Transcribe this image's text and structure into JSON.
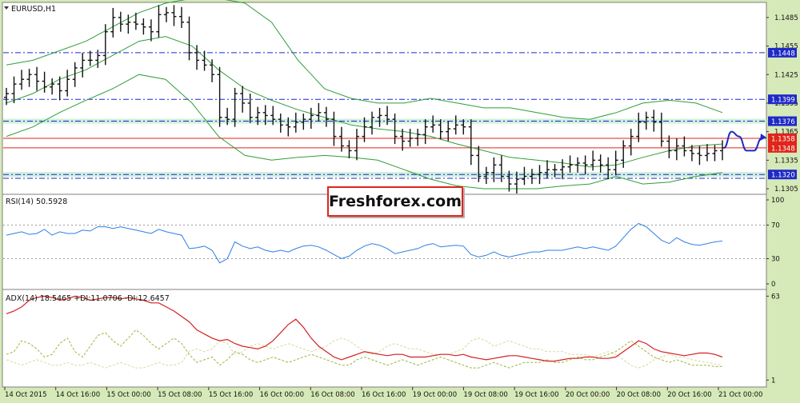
{
  "chart_data": [
    {
      "type": "candlestick",
      "title": "EURUSD,H1",
      "x_labels": [
        "14 Oct 2015",
        "14 Oct 16:00",
        "15 Oct 00:00",
        "15 Oct 08:00",
        "15 Oct 16:00",
        "16 Oct 00:00",
        "16 Oct 08:00",
        "16 Oct 16:00",
        "19 Oct 00:00",
        "19 Oct 08:00",
        "19 Oct 16:00",
        "20 Oct 00:00",
        "20 Oct 08:00",
        "20 Oct 16:00",
        "21 Oct 00:00"
      ],
      "y_ticks": [
        1.1305,
        1.1335,
        1.1365,
        1.1395,
        1.1425,
        1.1455,
        1.1485
      ],
      "ylim": [
        1.13,
        1.15
      ],
      "price_labels": [
        {
          "value": 1.1448,
          "text": "1.1448",
          "color": "#1f2ac6"
        },
        {
          "value": 1.1399,
          "text": "1.1399",
          "color": "#1f2ac6"
        },
        {
          "value": 1.1376,
          "text": "1.1376",
          "color": "#1f2ac6"
        },
        {
          "value": 1.1358,
          "text": "1.1358",
          "color": "#e0251b"
        },
        {
          "value": 1.1348,
          "text": "1.1348",
          "color": "#e0251b"
        },
        {
          "value": 1.132,
          "text": "1.1320",
          "color": "#1f2ac6"
        }
      ],
      "levels": [
        {
          "value": 1.1448,
          "style": "dash-dot",
          "color": "#1f2ac6"
        },
        {
          "value": 1.1399,
          "style": "dash-dot",
          "color": "#1f2ac6"
        },
        {
          "value": 1.1376,
          "style": "dash-dot",
          "color": "#1f2ac6",
          "band": true
        },
        {
          "value": 1.1358,
          "style": "solid",
          "color": "#e0251b"
        },
        {
          "value": 1.1348,
          "style": "solid",
          "color": "#e0251b"
        },
        {
          "value": 1.132,
          "style": "dash-dot",
          "color": "#1f2ac6",
          "band": true
        },
        {
          "value": 1.1316,
          "style": "dash-dot",
          "color": "#1f2ac6"
        }
      ],
      "close_series": [
        1.1405,
        1.1415,
        1.142,
        1.1425,
        1.1418,
        1.1412,
        1.1415,
        1.1408,
        1.142,
        1.1432,
        1.144,
        1.144,
        1.1445,
        1.147,
        1.1485,
        1.1478,
        1.148,
        1.1478,
        1.1475,
        1.147,
        1.1488,
        1.149,
        1.1486,
        1.148,
        1.1448,
        1.144,
        1.1435,
        1.1425,
        1.138,
        1.1378,
        1.1405,
        1.1395,
        1.138,
        1.1385,
        1.1382,
        1.1378,
        1.1372,
        1.137,
        1.1375,
        1.1378,
        1.1382,
        1.1385,
        1.1378,
        1.136,
        1.135,
        1.1345,
        1.136,
        1.137,
        1.138,
        1.1382,
        1.1378,
        1.136,
        1.1355,
        1.1358,
        1.1362,
        1.137,
        1.1372,
        1.1365,
        1.1368,
        1.1372,
        1.137,
        1.134,
        1.1318,
        1.1322,
        1.133,
        1.1318,
        1.131,
        1.1315,
        1.1318,
        1.132,
        1.1322,
        1.1325,
        1.1325,
        1.1328,
        1.133,
        1.1332,
        1.133,
        1.1335,
        1.133,
        1.1325,
        1.1335,
        1.135,
        1.136,
        1.1375,
        1.138,
        1.1375,
        1.1355,
        1.1345,
        1.135,
        1.1345,
        1.1342,
        1.134,
        1.1342,
        1.1345,
        1.1348
      ],
      "bollinger": {
        "upper": [
          1.1435,
          1.144,
          1.145,
          1.146,
          1.1475,
          1.149,
          1.15,
          1.1505,
          1.1505,
          1.15,
          1.148,
          1.144,
          1.141,
          1.14,
          1.1395,
          1.1395,
          1.14,
          1.1395,
          1.139,
          1.139,
          1.1385,
          1.138,
          1.1378,
          1.1385,
          1.1395,
          1.1398,
          1.1395,
          1.1385
        ],
        "middle": [
          1.1395,
          1.1405,
          1.142,
          1.143,
          1.1445,
          1.146,
          1.1465,
          1.1455,
          1.143,
          1.141,
          1.1398,
          1.1388,
          1.138,
          1.1372,
          1.1368,
          1.1365,
          1.136,
          1.1352,
          1.1345,
          1.1338,
          1.1335,
          1.1332,
          1.1328,
          1.133,
          1.1338,
          1.1345,
          1.135,
          1.1352
        ],
        "lower": [
          1.136,
          1.137,
          1.1385,
          1.1398,
          1.141,
          1.1425,
          1.142,
          1.1395,
          1.136,
          1.134,
          1.1335,
          1.1338,
          1.134,
          1.1338,
          1.1335,
          1.1325,
          1.1315,
          1.1308,
          1.1305,
          1.1305,
          1.1305,
          1.1308,
          1.131,
          1.1318,
          1.131,
          1.1312,
          1.1318,
          1.1322
        ]
      },
      "forecast": [
        1.1348,
        1.1365,
        1.136,
        1.1345,
        1.1345,
        1.1358
      ],
      "color_accent": "#1f2ac6",
      "color_candle": "#111111"
    },
    {
      "type": "line",
      "title": "RSI(14) 50.5928",
      "y_ticks": [
        0,
        30,
        70,
        100
      ],
      "ylim": [
        0,
        100
      ],
      "series": [
        {
          "name": "RSI(14)",
          "color": "#2e7fe6",
          "values": [
            58,
            60,
            62,
            59,
            60,
            65,
            58,
            62,
            60,
            60,
            64,
            63,
            68,
            68,
            66,
            68,
            66,
            64,
            62,
            60,
            65,
            62,
            60,
            58,
            42,
            43,
            45,
            40,
            25,
            30,
            50,
            45,
            42,
            44,
            40,
            38,
            40,
            38,
            42,
            45,
            46,
            44,
            40,
            35,
            30,
            33,
            40,
            45,
            48,
            46,
            42,
            36,
            38,
            40,
            42,
            46,
            48,
            44,
            45,
            46,
            45,
            35,
            32,
            34,
            38,
            34,
            32,
            34,
            36,
            38,
            38,
            40,
            40,
            40,
            42,
            44,
            42,
            44,
            42,
            40,
            45,
            55,
            65,
            72,
            68,
            60,
            52,
            48,
            55,
            50,
            47,
            46,
            48,
            50,
            51
          ]
        }
      ]
    },
    {
      "type": "line",
      "title": "ADX(14) 18.5465 +DI:11.0706 -DI:12.6457",
      "y_ticks": [
        1,
        63
      ],
      "ylim": [
        0,
        65
      ],
      "series": [
        {
          "name": "ADX(14)",
          "color": "#d42020",
          "values": [
            50,
            52,
            55,
            60,
            62,
            63,
            62,
            60,
            61,
            63,
            62,
            60,
            61,
            62,
            62,
            61,
            62,
            61,
            60,
            58,
            58,
            55,
            52,
            48,
            44,
            38,
            35,
            32,
            30,
            31,
            28,
            26,
            25,
            24,
            26,
            30,
            36,
            42,
            46,
            40,
            32,
            26,
            22,
            18,
            16,
            18,
            20,
            22,
            21,
            20,
            19,
            20,
            20,
            18,
            18,
            18,
            19,
            20,
            20,
            19,
            20,
            18,
            17,
            16,
            17,
            18,
            19,
            19,
            18,
            17,
            16,
            15,
            15,
            16,
            17,
            17,
            18,
            18,
            17,
            17,
            18,
            22,
            26,
            30,
            28,
            24,
            22,
            21,
            20,
            19,
            20,
            21,
            21,
            20,
            18
          ]
        },
        {
          "name": "+DI",
          "color": "#9ab83a",
          "values": [
            20,
            22,
            30,
            28,
            24,
            18,
            20,
            28,
            32,
            22,
            18,
            26,
            34,
            36,
            30,
            26,
            32,
            38,
            34,
            28,
            24,
            28,
            32,
            28,
            20,
            14,
            16,
            18,
            12,
            16,
            22,
            20,
            16,
            14,
            16,
            18,
            16,
            14,
            16,
            18,
            20,
            18,
            16,
            14,
            12,
            12,
            16,
            18,
            16,
            14,
            12,
            14,
            16,
            14,
            12,
            14,
            16,
            18,
            16,
            14,
            12,
            10,
            10,
            12,
            14,
            12,
            10,
            12,
            14,
            14,
            14,
            16,
            14,
            14,
            16,
            18,
            16,
            16,
            18,
            20,
            22,
            26,
            30,
            26,
            22,
            18,
            16,
            14,
            16,
            14,
            12,
            12,
            12,
            11,
            11
          ]
        },
        {
          "name": "-DI",
          "color": "#d8d89a",
          "values": [
            16,
            14,
            12,
            14,
            16,
            14,
            12,
            12,
            14,
            12,
            12,
            14,
            12,
            10,
            12,
            14,
            12,
            10,
            10,
            12,
            14,
            12,
            12,
            14,
            22,
            24,
            22,
            24,
            30,
            28,
            20,
            22,
            26,
            28,
            26,
            24,
            26,
            28,
            26,
            24,
            22,
            24,
            26,
            30,
            32,
            30,
            26,
            22,
            20,
            22,
            26,
            28,
            26,
            24,
            24,
            22,
            20,
            20,
            20,
            22,
            24,
            30,
            32,
            30,
            26,
            28,
            30,
            28,
            26,
            24,
            24,
            22,
            22,
            22,
            20,
            20,
            20,
            18,
            20,
            22,
            20,
            16,
            12,
            10,
            12,
            16,
            18,
            20,
            18,
            18,
            16,
            15,
            14,
            13,
            12
          ]
        }
      ]
    }
  ],
  "brand": {
    "label": "Freshforex.com"
  }
}
